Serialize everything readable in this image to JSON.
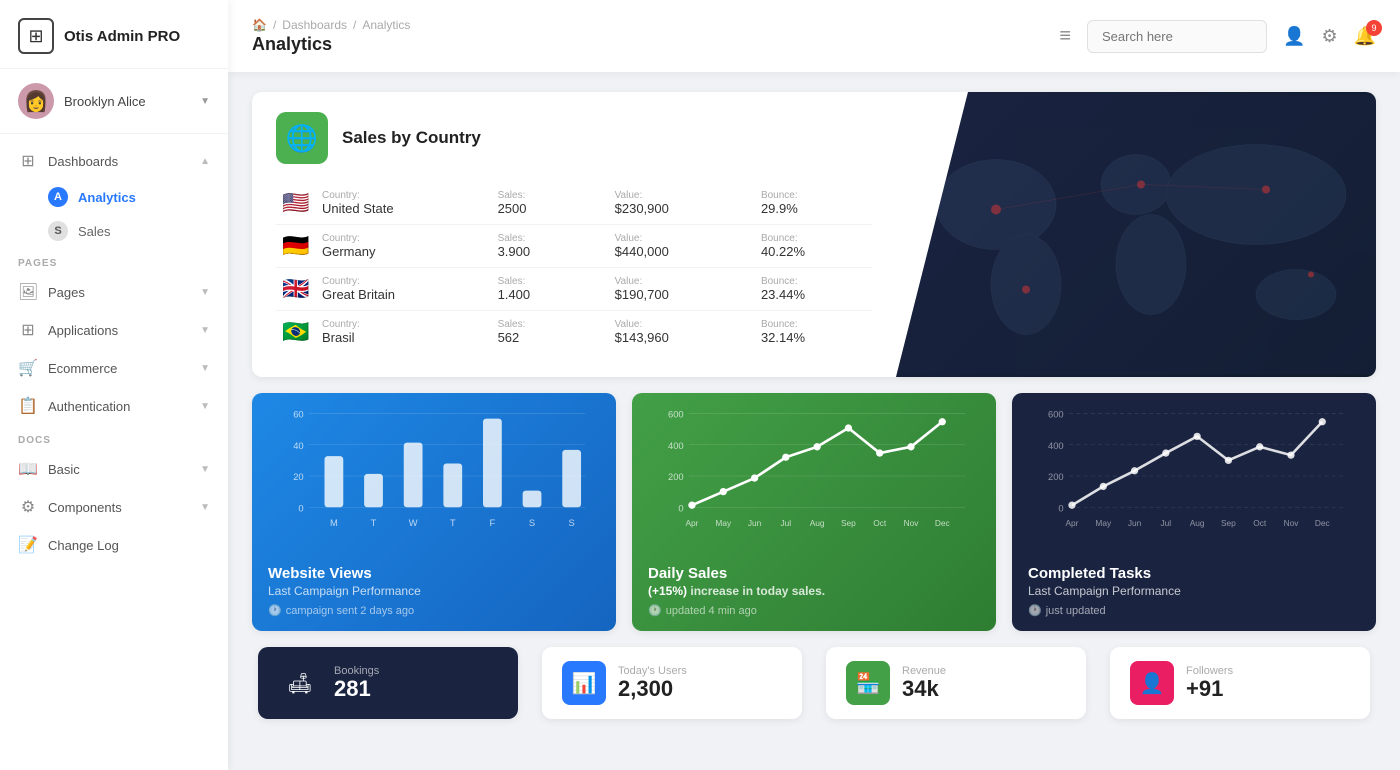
{
  "app": {
    "name": "Otis Admin PRO",
    "logo_symbol": "⊞"
  },
  "user": {
    "name": "Brooklyn Alice",
    "avatar_emoji": "👩"
  },
  "sidebar": {
    "sections": [
      {
        "label": "",
        "items": [
          {
            "id": "dashboards",
            "icon": "⊞",
            "label": "Dashboards",
            "chevron": "▲",
            "active": false,
            "expanded": true
          },
          {
            "id": "analytics",
            "icon": "A",
            "label": "Analytics",
            "active": true,
            "sub": true
          },
          {
            "id": "sales",
            "icon": "S",
            "label": "Sales",
            "active": false,
            "sub": true
          }
        ]
      },
      {
        "label": "PAGES",
        "items": [
          {
            "id": "pages",
            "icon": "🖼",
            "label": "Pages",
            "chevron": "▼"
          },
          {
            "id": "applications",
            "icon": "⊞",
            "label": "Applications",
            "chevron": "▼"
          },
          {
            "id": "ecommerce",
            "icon": "🛒",
            "label": "Ecommerce",
            "chevron": "▼"
          },
          {
            "id": "authentication",
            "icon": "📋",
            "label": "Authentication",
            "chevron": "▼"
          }
        ]
      },
      {
        "label": "DOCS",
        "items": [
          {
            "id": "basic",
            "icon": "📖",
            "label": "Basic",
            "chevron": "▼"
          },
          {
            "id": "components",
            "icon": "⚙",
            "label": "Components",
            "chevron": "▼"
          },
          {
            "id": "changelog",
            "icon": "📝",
            "label": "Change Log"
          }
        ]
      }
    ]
  },
  "topbar": {
    "breadcrumb": [
      "🏠",
      "Dashboards",
      "Analytics"
    ],
    "title": "Analytics",
    "menu_icon": "≡",
    "search_placeholder": "Search here",
    "notification_count": "9"
  },
  "sales_by_country": {
    "title": "Sales by Country",
    "countries": [
      {
        "flag": "🇺🇸",
        "country_label": "Country:",
        "country": "United State",
        "sales_label": "Sales:",
        "sales": "2500",
        "value_label": "Value:",
        "value": "$230,900",
        "bounce_label": "Bounce:",
        "bounce": "29.9%"
      },
      {
        "flag": "🇩🇪",
        "country_label": "Country:",
        "country": "Germany",
        "sales_label": "Sales:",
        "sales": "3.900",
        "value_label": "Value:",
        "value": "$440,000",
        "bounce_label": "Bounce:",
        "bounce": "40.22%"
      },
      {
        "flag": "🇬🇧",
        "country_label": "Country:",
        "country": "Great Britain",
        "sales_label": "Sales:",
        "sales": "1.400",
        "value_label": "Value:",
        "value": "$190,700",
        "bounce_label": "Bounce:",
        "bounce": "23.44%"
      },
      {
        "flag": "🇧🇷",
        "country_label": "Country:",
        "country": "Brasil",
        "sales_label": "Sales:",
        "sales": "562",
        "value_label": "Value:",
        "value": "$143,960",
        "bounce_label": "Bounce:",
        "bounce": "32.14%"
      }
    ]
  },
  "charts": {
    "website_views": {
      "title": "Website Views",
      "subtitle": "Last Campaign Performance",
      "footer": "campaign sent 2 days ago",
      "y_labels": [
        "60",
        "40",
        "20",
        "0"
      ],
      "x_labels": [
        "M",
        "T",
        "W",
        "T",
        "F",
        "S",
        "S"
      ],
      "bars": [
        30,
        20,
        40,
        25,
        55,
        10,
        35
      ]
    },
    "daily_sales": {
      "title": "Daily Sales",
      "subtitle_prefix": "(+15%)",
      "subtitle": " increase in today sales.",
      "footer": "updated 4 min ago",
      "y_labels": [
        "600",
        "400",
        "200",
        "0"
      ],
      "x_labels": [
        "Apr",
        "May",
        "Jun",
        "Jul",
        "Aug",
        "Sep",
        "Oct",
        "Nov",
        "Dec"
      ],
      "points": [
        10,
        80,
        150,
        280,
        350,
        480,
        300,
        350,
        500
      ]
    },
    "completed_tasks": {
      "title": "Completed Tasks",
      "subtitle": "Last Campaign Performance",
      "footer": "just updated",
      "y_labels": [
        "600",
        "400",
        "200",
        "0"
      ],
      "x_labels": [
        "Apr",
        "May",
        "Jun",
        "Jul",
        "Aug",
        "Sep",
        "Oct",
        "Nov",
        "Dec"
      ],
      "points": [
        20,
        120,
        200,
        320,
        400,
        280,
        350,
        300,
        480
      ]
    }
  },
  "stats": [
    {
      "icon": "🛋",
      "icon_class": "dark",
      "label": "Bookings",
      "value": "281"
    },
    {
      "icon": "📊",
      "icon_class": "blue",
      "label": "Today's Users",
      "value": "2,300"
    },
    {
      "icon": "🏪",
      "icon_class": "green",
      "label": "Revenue",
      "value": "34k"
    },
    {
      "icon": "👤",
      "icon_class": "pink",
      "label": "Followers",
      "value": "+91"
    }
  ]
}
